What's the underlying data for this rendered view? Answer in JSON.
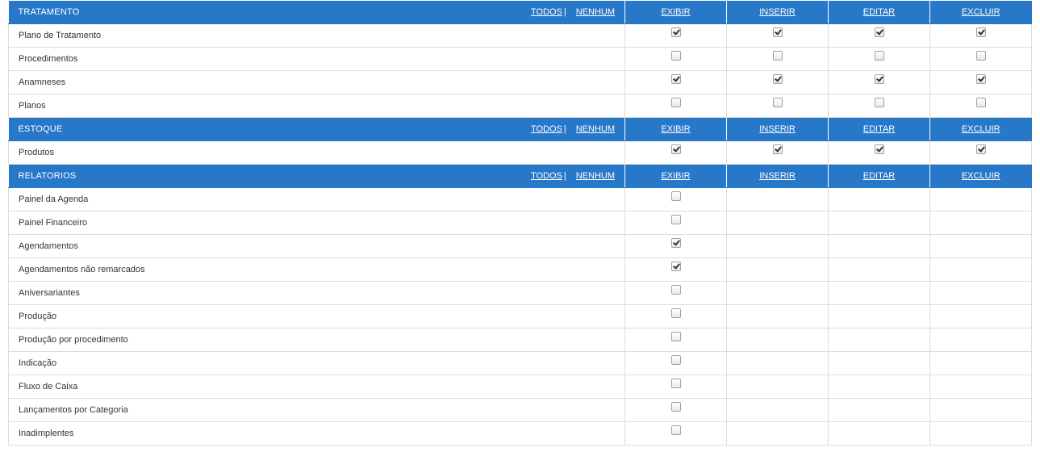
{
  "actions": [
    "EXIBIR",
    "INSERIR",
    "EDITAR",
    "EXCLUIR"
  ],
  "links": {
    "all": "TODOS",
    "none": "NENHUM",
    "sep": "|"
  },
  "sections": [
    {
      "title": "TRATAMENTO",
      "rows": [
        {
          "label": "Plano de Tratamento",
          "checks": [
            true,
            true,
            true,
            true
          ]
        },
        {
          "label": "Procedimentos",
          "checks": [
            false,
            false,
            false,
            false
          ]
        },
        {
          "label": "Anamneses",
          "checks": [
            true,
            true,
            true,
            true
          ]
        },
        {
          "label": "Planos",
          "checks": [
            false,
            false,
            false,
            false
          ]
        }
      ]
    },
    {
      "title": "ESTOQUE",
      "rows": [
        {
          "label": "Produtos",
          "checks": [
            true,
            true,
            true,
            true
          ]
        }
      ]
    },
    {
      "title": "RELATORIOS",
      "rows": [
        {
          "label": "Painel da Agenda",
          "checks": [
            false,
            null,
            null,
            null
          ]
        },
        {
          "label": "Painel Financeiro",
          "checks": [
            false,
            null,
            null,
            null
          ]
        },
        {
          "label": "Agendamentos",
          "checks": [
            true,
            null,
            null,
            null
          ]
        },
        {
          "label": "Agendamentos não remarcados",
          "checks": [
            true,
            null,
            null,
            null
          ]
        },
        {
          "label": "Aniversariantes",
          "checks": [
            false,
            null,
            null,
            null
          ]
        },
        {
          "label": "Produção",
          "checks": [
            false,
            null,
            null,
            null
          ]
        },
        {
          "label": "Produção por procedimento",
          "checks": [
            false,
            null,
            null,
            null
          ]
        },
        {
          "label": "Indicação",
          "checks": [
            false,
            null,
            null,
            null
          ]
        },
        {
          "label": "Fluxo de Caixa",
          "checks": [
            false,
            null,
            null,
            null
          ]
        },
        {
          "label": "Lançamentos por Categoria",
          "checks": [
            false,
            null,
            null,
            null
          ]
        },
        {
          "label": "Inadimplentes",
          "checks": [
            false,
            null,
            null,
            null
          ]
        }
      ]
    }
  ]
}
